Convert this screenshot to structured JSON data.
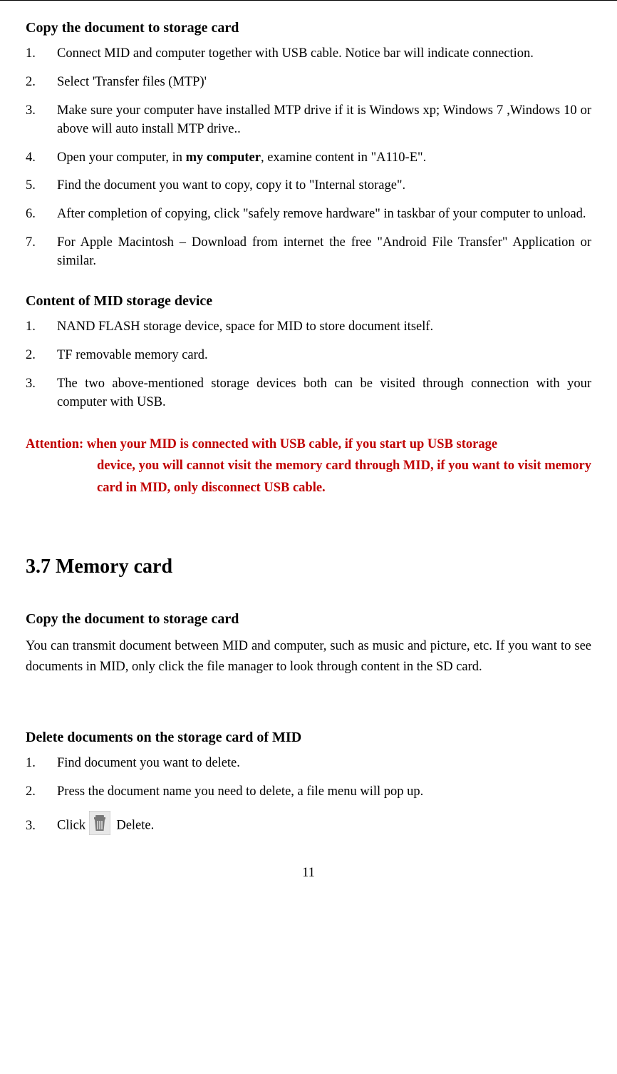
{
  "copySection": {
    "title": "Copy the document to storage card",
    "items": [
      {
        "num": "1.",
        "pre": "Connect MID and computer together with USB cable. Notice bar will indicate connection."
      },
      {
        "num": "2.",
        "pre": "Select 'Transfer files (MTP)'"
      },
      {
        "num": "3.",
        "pre": "Make sure your computer have installed MTP drive if it is Windows xp; Windows 7 ,Windows 10 or above will auto install MTP drive.."
      },
      {
        "num": "4.",
        "pre": "Open your computer, in ",
        "bold": "my computer",
        "post": ", examine content in \"A110-E\"."
      },
      {
        "num": "5.",
        "pre": "Find the document you want to copy, copy it to \"Internal storage\"."
      },
      {
        "num": "6.",
        "pre": "After completion of copying, click \"safely remove hardware\" in taskbar of your computer to unload."
      },
      {
        "num": "7.",
        "pre": "For Apple Macintosh – Download from internet the free \"Android File Transfer\" Application or similar."
      }
    ]
  },
  "contentSection": {
    "title": "Content of MID storage device",
    "items": [
      {
        "num": "1.",
        "pre": "NAND FLASH storage device, space for MID to store document itself."
      },
      {
        "num": "2.",
        "pre": "TF removable memory card."
      },
      {
        "num": "3.",
        "pre": "The two above-mentioned storage devices both can be visited through connection with your computer with USB."
      }
    ]
  },
  "attention": {
    "firstLine": "Attention: when your MID is connected with USB cable, if you start up USB storage",
    "rest": "device, you will cannot visit the memory card through MID, if you want to visit memory card in MID, only disconnect USB cable."
  },
  "memoryCard": {
    "heading": "3.7  Memory card",
    "copyTitle": "Copy the document to storage card",
    "copyPara": "You can transmit document between MID and computer, such as music and picture, etc. If you want to see documents in MID, only click the file manager to look through content in the SD card.",
    "deleteTitle": "Delete documents on the storage card of MID",
    "deleteItems": [
      {
        "num": "1.",
        "pre": "Find document you want to delete."
      },
      {
        "num": "2.",
        "pre": "Press the document name you need to delete, a file menu will pop up."
      },
      {
        "num": "3.",
        "pre": "Click  ",
        "icon": "trash-icon",
        "post": " Delete."
      }
    ]
  },
  "pageNumber": "11"
}
